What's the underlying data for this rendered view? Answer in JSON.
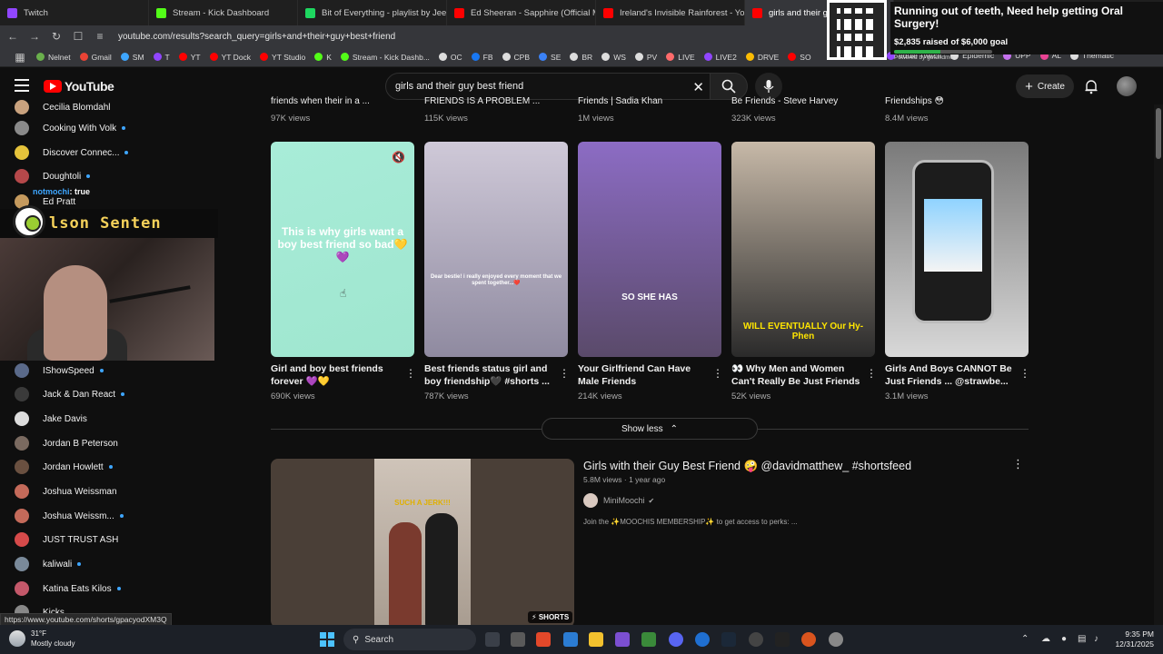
{
  "browser": {
    "tabs": [
      {
        "label": "Twitch",
        "color": "#9146ff",
        "active": false
      },
      {
        "label": "Stream - Kick Dashboard",
        "color": "#53fc18",
        "active": false
      },
      {
        "label": "Bit of Everything - playlist by Jeep W",
        "color": "#1ed760",
        "active": false
      },
      {
        "label": "Ed Sheeran - Sapphire (Official Music",
        "color": "#ff0000",
        "active": false
      },
      {
        "label": "Ireland's Invisible Rainforest - YouTu",
        "color": "#ff0000",
        "active": false
      },
      {
        "label": "girls and their guy",
        "color": "#ff0000",
        "active": true
      }
    ],
    "url": "youtube.com/results?search_query=girls+and+their+guy+best+friend",
    "bookmarks": [
      {
        "label": "Nelnet",
        "color": "#6ab04c"
      },
      {
        "label": "Gmail",
        "color": "#ea4335"
      },
      {
        "label": "SM",
        "color": "#3ea6ff"
      },
      {
        "label": "T",
        "color": "#9146ff"
      },
      {
        "label": "YT",
        "color": "#ff0000"
      },
      {
        "label": "YT Dock",
        "color": "#ff0000"
      },
      {
        "label": "YT Studio",
        "color": "#ff0000"
      },
      {
        "label": "K",
        "color": "#53fc18"
      },
      {
        "label": "Stream - Kick Dashb...",
        "color": "#53fc18"
      },
      {
        "label": "OC",
        "color": "#dddddd"
      },
      {
        "label": "FB",
        "color": "#1877f2"
      },
      {
        "label": "CPB",
        "color": "#dddddd"
      },
      {
        "label": "SE",
        "color": "#3b82f6"
      },
      {
        "label": "BR",
        "color": "#dddddd"
      },
      {
        "label": "WS",
        "color": "#dddddd"
      },
      {
        "label": "PV",
        "color": "#dddddd"
      },
      {
        "label": "LIVE",
        "color": "#ff6b6b"
      },
      {
        "label": "LIVE2",
        "color": "#9146ff"
      },
      {
        "label": "DRVE",
        "color": "#fbbc04"
      },
      {
        "label": "SO",
        "color": "#ff0000"
      }
    ],
    "bookmarks_right": [
      {
        "label": "edule Twitch",
        "color": "#9146ff"
      },
      {
        "label": "Epidemic",
        "color": "#dddddd"
      },
      {
        "label": "UPP",
        "color": "#c471ed"
      },
      {
        "label": "AL",
        "color": "#e84393"
      },
      {
        "label": "Thematic",
        "color": "#dddddd"
      }
    ]
  },
  "donation": {
    "title": "Running out of teeth, Need help getting Oral Surgery!",
    "raised": "$2,835 raised of $6,000 goal",
    "progress": 0.4725,
    "powered": "Powered by gofundme"
  },
  "youtube": {
    "logo_text": "YouTube",
    "search_value": "girls and their guy best friend",
    "create_label": "Create"
  },
  "sidebar": {
    "items": [
      {
        "label": "Cecilia Blomdahl",
        "color": "#c9a27e",
        "live": false
      },
      {
        "label": "Cooking With Volk",
        "color": "#8a8a8a",
        "live": true
      },
      {
        "label": "Discover Connec...",
        "color": "#e5c33b",
        "live": true
      },
      {
        "label": "Doughtoli",
        "color": "#b5484a",
        "live": true
      },
      {
        "label": "Ed Pratt",
        "color": "#c59a5e",
        "live": false
      },
      {
        "label": "IShowSpeed",
        "color": "#5a6a8a",
        "live": true
      },
      {
        "label": "Jack & Dan React",
        "color": "#3a3a3a",
        "live": true
      },
      {
        "label": "Jake Davis",
        "color": "#dcdcdc",
        "live": false
      },
      {
        "label": "Jordan B Peterson",
        "color": "#7a6a60",
        "live": false
      },
      {
        "label": "Jordan Howlett",
        "color": "#6a5040",
        "live": true
      },
      {
        "label": "Joshua Weissman",
        "color": "#c46a5a",
        "live": false
      },
      {
        "label": "Joshua Weissm...",
        "color": "#c46a5a",
        "live": true
      },
      {
        "label": "JUST TRUST ASH",
        "color": "#d64a4a",
        "live": false
      },
      {
        "label": "kaliwali",
        "color": "#7a8a9a",
        "live": true
      },
      {
        "label": "Katina Eats Kilos",
        "color": "#c4586a",
        "live": true
      },
      {
        "label": "Kicks",
        "color": "#888888",
        "live": false
      }
    ]
  },
  "overlay": {
    "chat_user": "notmochi",
    "chat_value": ": true",
    "banner_text": "lson Senten"
  },
  "prev_row": [
    {
      "title": "friends when their in a ...",
      "views": "97K views"
    },
    {
      "title": "FRIENDS IS A PROBLEM ...",
      "views": "115K views"
    },
    {
      "title": "Friends | Sadia Khan",
      "views": "1M views"
    },
    {
      "title": "Be Friends - Steve Harvey",
      "views": "323K views"
    },
    {
      "title": "Friendships 😳",
      "views": "8.4M views"
    }
  ],
  "shorts": [
    {
      "title": "Girl and boy best friends forever 💜💛",
      "views": "690K views",
      "thumb_text": "This is why girls want a boy best friend so bad💛💜"
    },
    {
      "title": "Best friends status girl and boy friendship🖤 #shorts ...",
      "views": "787K views",
      "thumb_text": "Dear bestie! i really enjoyed every moment that we spent together...❤️"
    },
    {
      "title": "Your Girlfriend Can Have Male Friends",
      "views": "214K views",
      "thumb_text": "SO SHE HAS"
    },
    {
      "title": "👀 Why Men and Women Can't Really Be Just Friends",
      "views": "52K views",
      "thumb_text": "WILL EVENTUALLY Our Hy-Phen"
    },
    {
      "title": "Girls And Boys CANNOT Be Just Friends ... @strawbe...",
      "views": "3.1M views",
      "thumb_text": ""
    }
  ],
  "show_less": "Show less",
  "video": {
    "title": "Girls with their Guy Best Friend 🤪 @davidmatthew_ #shortsfeed",
    "meta": "5.8M views · 1 year ago",
    "channel": "MiniMoochi",
    "desc": "Join the ✨MOOCHIS MEMBERSHIP✨ to get access to perks: ...",
    "badge": "SHORTS",
    "thumb_text": "SUCH A JERK!!!"
  },
  "status_url": "https://www.youtube.com/shorts/gpacyodXM3Q",
  "taskbar": {
    "temp": "31°F",
    "weather": "Mostly cloudy",
    "search": "Search",
    "time": "9:35 PM",
    "date": "12/31/2025"
  }
}
